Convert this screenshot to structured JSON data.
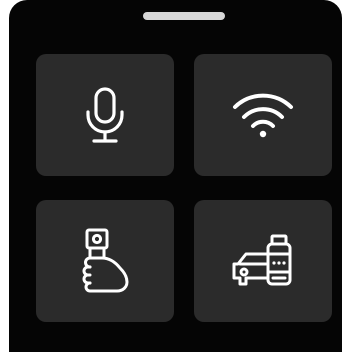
{
  "panel": {
    "tiles": [
      {
        "icon": "microphone-icon"
      },
      {
        "icon": "wifi-icon"
      },
      {
        "icon": "hand-camera-icon"
      },
      {
        "icon": "car-device-icon"
      }
    ]
  },
  "colors": {
    "background": "#050505",
    "tile": "#2b2b2b",
    "icon": "#ffffff",
    "handle": "#d7d7d7"
  }
}
